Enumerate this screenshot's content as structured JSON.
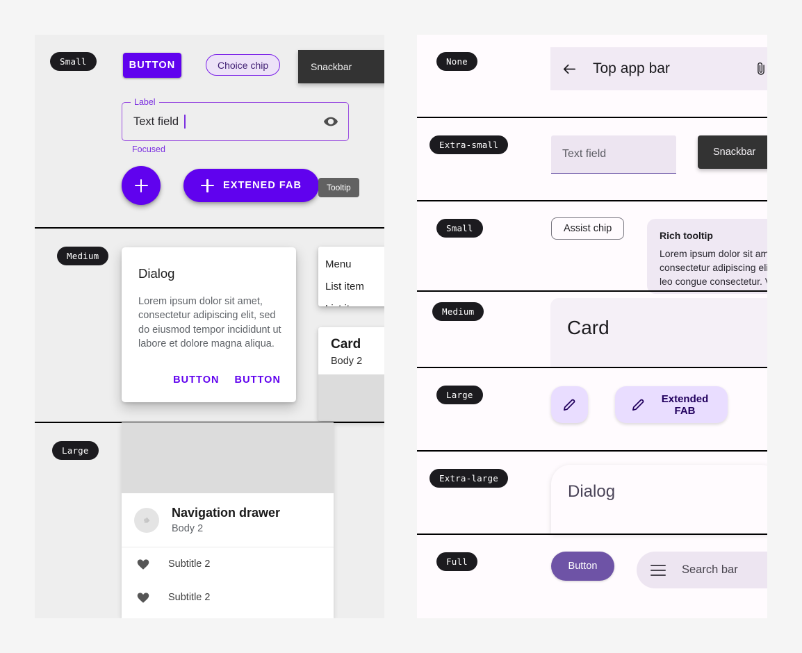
{
  "left_panel": {
    "rows": [
      {
        "size_label": "Small",
        "button_label": "BUTTON",
        "chip_label": "Choice chip",
        "snackbar_label": "Snackbar",
        "textfield": {
          "legend": "Label",
          "value": "Text field",
          "helper": "Focused",
          "trailing_icon": "eye-icon"
        },
        "fab_icon": "plus-icon",
        "extended_fab_label": "EXTENED FAB",
        "tooltip_label": "Tooltip"
      },
      {
        "size_label": "Medium",
        "dialog": {
          "title": "Dialog",
          "body": "Lorem ipsum dolor sit amet, consectetur adipiscing elit, sed do eiusmod tempor incididunt ut labore et dolore magna aliqua.",
          "action_1": "BUTTON",
          "action_2": "BUTTON"
        },
        "menu": {
          "header": "Menu",
          "items": [
            "List item",
            "List item"
          ]
        },
        "card": {
          "title": "Card",
          "subtitle": "Body 2"
        }
      },
      {
        "size_label": "Large",
        "nav_drawer": {
          "title": "Navigation drawer",
          "subtitle": "Body 2",
          "items": [
            {
              "icon": "heart-icon",
              "label": "Subtitle 2"
            },
            {
              "icon": "heart-icon",
              "label": "Subtitle 2"
            }
          ]
        }
      }
    ]
  },
  "right_panel": {
    "rows": [
      {
        "size_label": "None",
        "app_bar": {
          "back_icon": "arrow-back-icon",
          "title": "Top app bar",
          "action_icon": "attachment-icon"
        }
      },
      {
        "size_label": "Extra-small",
        "textfield_placeholder": "Text field",
        "snackbar_label": "Snackbar"
      },
      {
        "size_label": "Small",
        "assist_chip_label": "Assist chip",
        "rich_tooltip": {
          "title": "Rich tooltip",
          "body": "Lorem ipsum dolor sit amet, consectetur adipiscing elit. Nullam et leo congue consectetur. Vivamus"
        }
      },
      {
        "size_label": "Medium",
        "card_title": "Card"
      },
      {
        "size_label": "Large",
        "fab_icon": "pencil-icon",
        "extended_fab_label": "Extended FAB",
        "extended_fab_icon": "pencil-icon"
      },
      {
        "size_label": "Extra-large",
        "dialog_title": "Dialog"
      },
      {
        "size_label": "Full",
        "button_label": "Button",
        "search_bar": {
          "menu_icon": "hamburger-icon",
          "placeholder": "Search bar"
        }
      }
    ]
  },
  "colors": {
    "page_background": "#F5F5F5",
    "left_panel_background": "#EEEEEE",
    "right_panel_background": "#FFFBFE",
    "m2_primary": "#6002EE",
    "m2_snackbar": "#333333",
    "m2_tooltip": "#616161",
    "m3_primary_container": "#E9DDFF",
    "m3_on_primary_container": "#21005D",
    "m3_surface_variant": "#EDE5F1",
    "m3_filled_button": "#6E53A6",
    "size_pill": "#1C1B1F"
  }
}
